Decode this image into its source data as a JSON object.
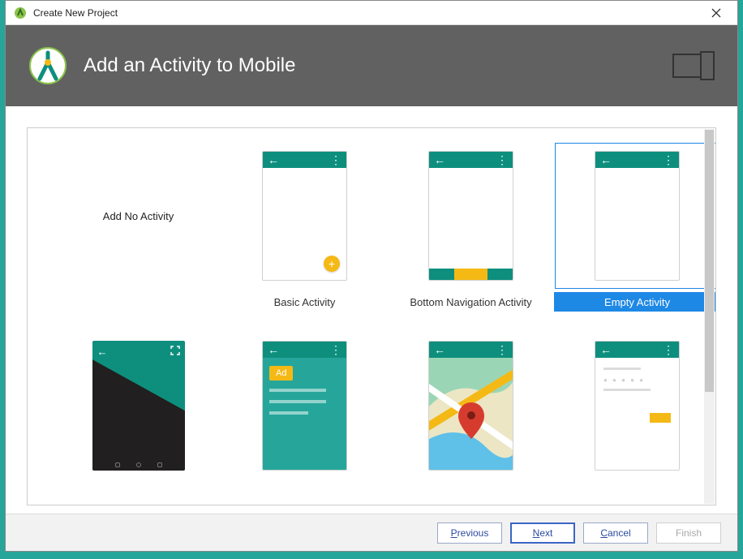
{
  "window": {
    "title": "Create New Project"
  },
  "header": {
    "title": "Add an Activity to Mobile"
  },
  "templates": [
    {
      "label": "Add No Activity",
      "kind": "none",
      "selected": false
    },
    {
      "label": "Basic Activity",
      "kind": "basic",
      "selected": false
    },
    {
      "label": "Bottom Navigation Activity",
      "kind": "bottomnav",
      "selected": false
    },
    {
      "label": "Empty Activity",
      "kind": "empty",
      "selected": true
    },
    {
      "label": "",
      "kind": "fullscreen",
      "selected": false
    },
    {
      "label": "",
      "kind": "ad",
      "selected": false
    },
    {
      "label": "",
      "kind": "map",
      "selected": false
    },
    {
      "label": "",
      "kind": "form",
      "selected": false
    }
  ],
  "ad": {
    "badge": "Ad"
  },
  "buttons": {
    "previous": "Previous",
    "next": "Next",
    "cancel": "Cancel",
    "finish": "Finish"
  }
}
